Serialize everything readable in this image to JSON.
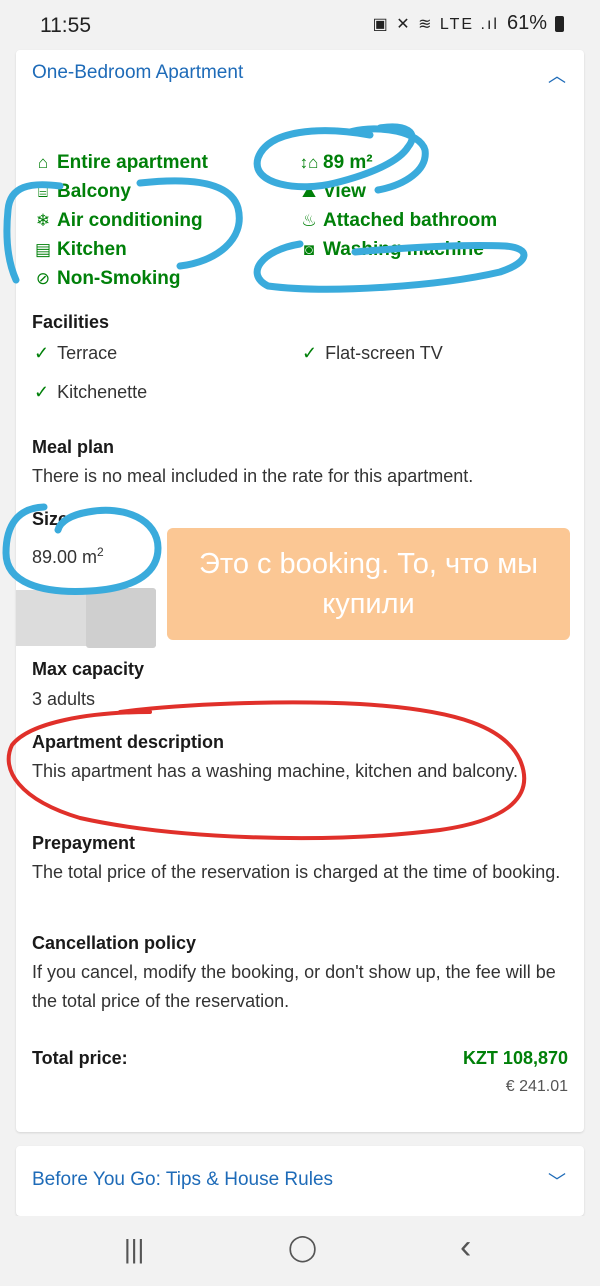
{
  "status": {
    "time": "11:55",
    "battery": "61%",
    "icons_text": "▣ ✕ ≋ LTE .ıl"
  },
  "room": {
    "title": "One-Bedroom Apartment",
    "amenities_left": [
      {
        "label": "Entire apartment",
        "icon": "⌂",
        "icon_name": "home-icon"
      },
      {
        "label": "Balcony",
        "icon": "⌸",
        "icon_name": "balcony-icon"
      },
      {
        "label": "Air conditioning",
        "icon": "❄",
        "icon_name": "snowflake-icon"
      },
      {
        "label": "Kitchen",
        "icon": "▤",
        "icon_name": "kitchen-icon"
      },
      {
        "label": "Non-Smoking",
        "icon": "⊘",
        "icon_name": "no-smoking-icon"
      }
    ],
    "amenities_right": [
      {
        "label": "89 m²",
        "icon": "↕⌂",
        "icon_name": "area-icon"
      },
      {
        "label": "View",
        "icon": "⛰",
        "icon_name": "mountain-icon"
      },
      {
        "label": "Attached bathroom",
        "icon": "♨",
        "icon_name": "shower-icon"
      },
      {
        "label": "Washing machine",
        "icon": "◙",
        "icon_name": "washing-machine-icon"
      }
    ],
    "facilities_heading": "Facilities",
    "facilities": [
      "Terrace",
      "Flat-screen TV",
      "Kitchenette"
    ],
    "check_icon": "✓",
    "meal_heading": "Meal plan",
    "meal_text": "There is no meal included in the rate for this apartment.",
    "size_heading": "Size",
    "size_value": "89.00 m",
    "size_sup": "2",
    "capacity_heading": "Max capacity",
    "capacity_text": "3 adults",
    "desc_heading": "Apartment description",
    "desc_text": "This apartment has a washing machine, kitchen and balcony.",
    "prepay_heading": "Prepayment",
    "prepay_text": "The total price of the reservation is charged at the time of booking.",
    "cancel_heading": "Cancellation policy",
    "cancel_text": "If you cancel, modify the booking, or don't show up, the fee will be the total price of the reservation.",
    "total_label": "Total price:",
    "total_price": "KZT 108,870",
    "total_eur": "€ 241.01"
  },
  "overlay_note": "Это с booking. То, что мы купили",
  "before_you_go": "Before You Go: Tips & House Rules",
  "nav": {
    "recent": "|||",
    "home": "◯",
    "back": "‹"
  },
  "colors": {
    "link": "#1e6bb8",
    "green": "#008009",
    "annotation_blue": "#3aabdc",
    "annotation_red": "#e0302a",
    "note_bg": "#fbc794"
  }
}
